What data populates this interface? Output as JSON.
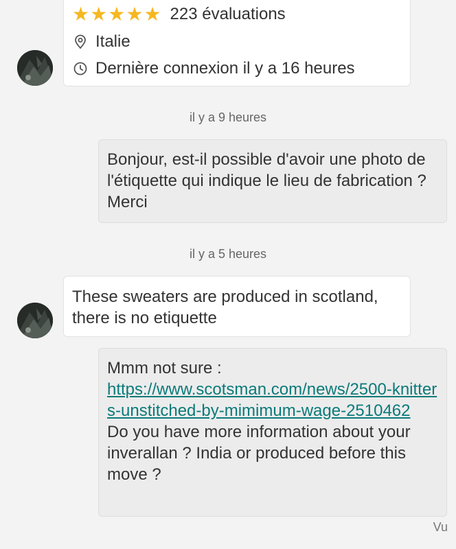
{
  "profile_card": {
    "rating_text": "223 évaluations",
    "stars": 5,
    "star_color": "#f5b820",
    "location": "Italie",
    "last_seen": "Dernière connexion il y a 16 heures",
    "location_icon": "location-pin-icon",
    "clock_icon": "clock-icon"
  },
  "messages": [
    {
      "timestamp": "il y a 9 heures"
    },
    {
      "text": "Bonjour, est-il possible d'avoir une photo de l'étiquette qui indique le lieu de fabrication ? Merci"
    },
    {
      "timestamp": "il y a 5 heures"
    },
    {
      "text": "These sweaters are produced in scotland, there is no etiquette"
    },
    {
      "text_before": "Mmm not sure :",
      "link": "https://www.scotsman.com/news/2500-knitters-unstitched-by-mimimum-wage-2510462",
      "text_after": "Do you have more information about your inverallan ? India or produced before this move ?"
    }
  ],
  "read_status": "Vu",
  "colors": {
    "background": "#f3f3f3",
    "link": "#0b7a7a",
    "outgoing_bubble": "#ececec"
  }
}
